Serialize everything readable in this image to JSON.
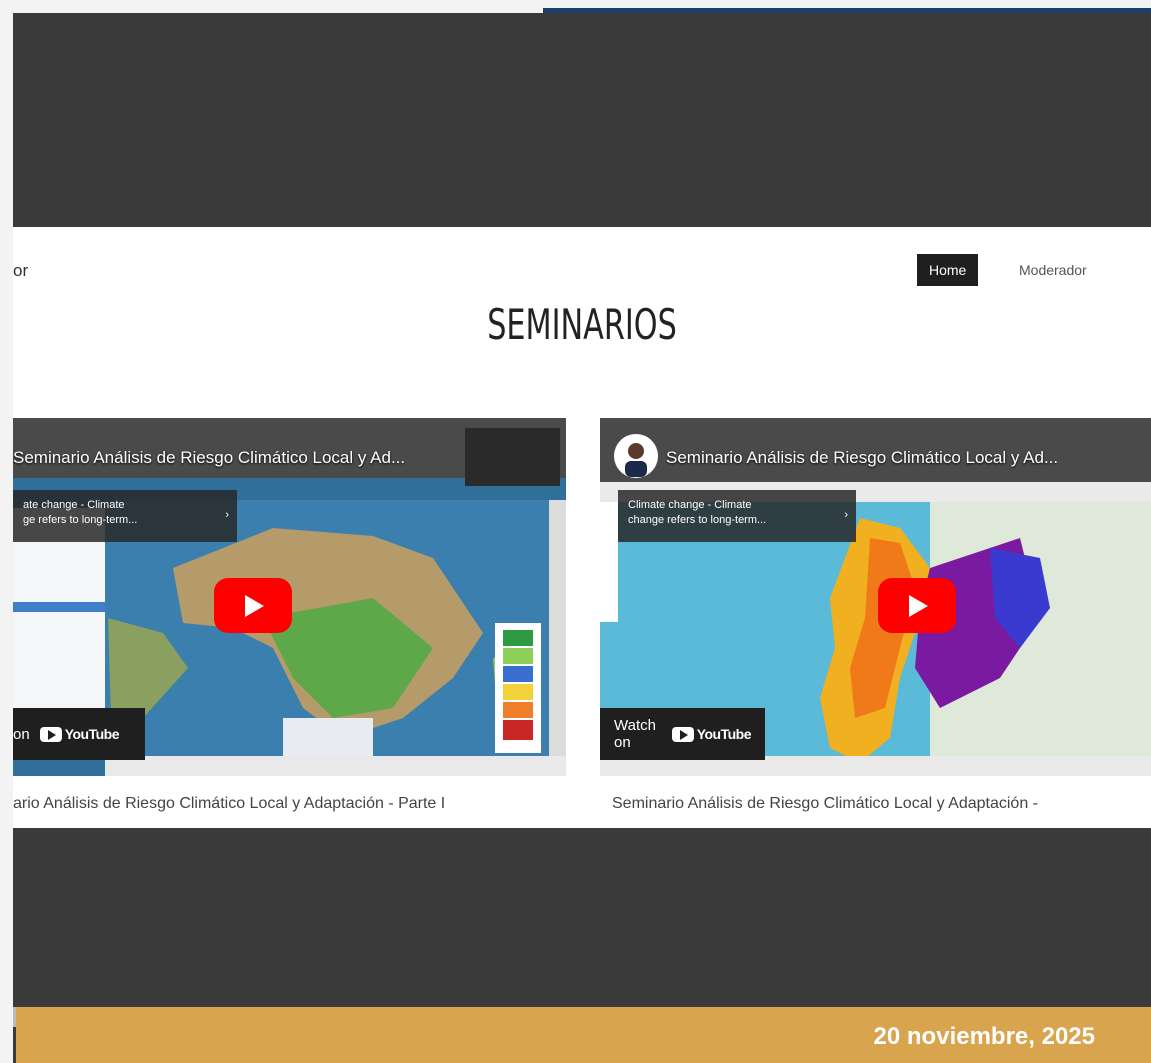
{
  "nav": {
    "brand_partial": "or",
    "items": [
      {
        "label": "Home",
        "active": true
      },
      {
        "label": "Moderador",
        "active": false
      }
    ]
  },
  "section": {
    "title": "SEMINARIOS"
  },
  "videos": [
    {
      "title": "Seminario Análisis de Riesgo Climático Local y Ad...",
      "tooltip": "ate change - Climate\nge refers to long-term...",
      "watch_label": "on",
      "youtube_label": "YouTube",
      "caption": "ario Análisis de Riesgo Climático Local y Adaptación - Parte I"
    },
    {
      "title": "Seminario Análisis de Riesgo Climático Local y Ad...",
      "tooltip": "Climate change - Climate\nchange refers to long-term...",
      "watch_label": "Watch on",
      "youtube_label": "YouTube",
      "caption": "Seminario Análisis de Riesgo Climático Local y Adaptación -"
    }
  ],
  "footer": {
    "date": "20 noviembre, 2025"
  },
  "colors": {
    "dark_band": "#3a3a3a",
    "gold_bar": "#d9a44e",
    "accent_line": "#1b3f66",
    "youtube_red": "#ff0000"
  }
}
